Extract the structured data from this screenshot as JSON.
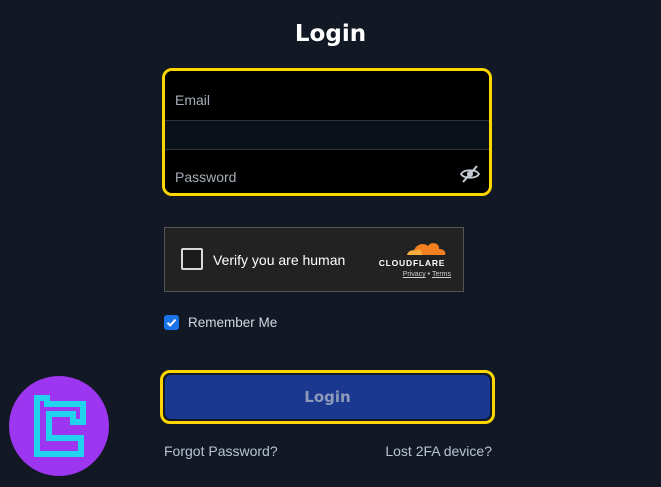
{
  "page": {
    "title": "Login"
  },
  "form": {
    "email_placeholder": "Email",
    "password_placeholder": "Password",
    "remember_label": "Remember Me",
    "remember_checked": true,
    "login_button_label": "Login"
  },
  "captcha": {
    "label": "Verify you are human",
    "brand": "CLOUDFLARE",
    "privacy_link": "Privacy",
    "separator": "•",
    "terms_link": "Terms"
  },
  "links": {
    "forgot_password": "Forgot Password?",
    "lost_2fa": "Lost 2FA device?"
  },
  "icons": {
    "password_toggle": "eye-slash-icon",
    "cloudflare": "cloudflare-cloud-icon",
    "brand": "tc-logo-icon",
    "checkbox": "checkmark-icon"
  },
  "colors": {
    "background": "#121925",
    "highlight": "#ffd500",
    "button": "#1b3890",
    "checkbox": "#1a73e8",
    "cloudflare_orange": "#f38020",
    "brand_purple": "#9c36f0",
    "brand_cyan": "#22d3ee"
  }
}
